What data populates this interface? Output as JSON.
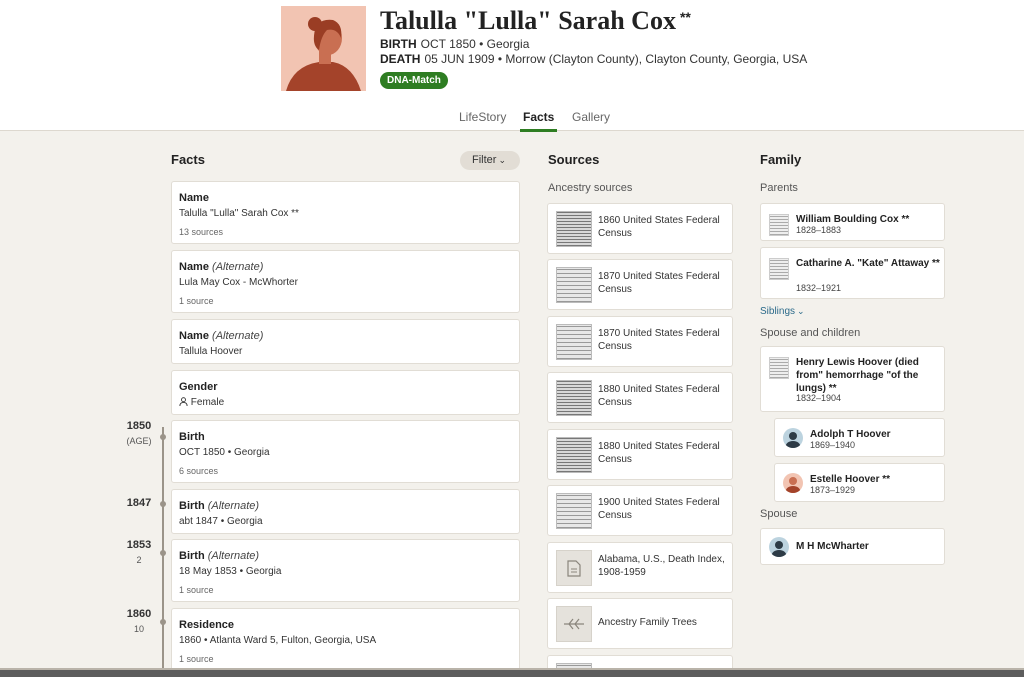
{
  "person": {
    "name": "Talulla \"Lulla\" Sarah Cox",
    "stars": "**",
    "birth_label": "BIRTH",
    "birth_value": "OCT 1850 • Georgia",
    "death_label": "DEATH",
    "death_value": "05 JUN 1909 • Morrow (Clayton County), Clayton County, Georgia, USA",
    "badge": "DNA-Match"
  },
  "tabs": [
    {
      "label": "LifeStory",
      "active": false
    },
    {
      "label": "Facts",
      "active": true
    },
    {
      "label": "Gallery",
      "active": false
    }
  ],
  "facts": {
    "title": "Facts",
    "filter_label": "Filter",
    "items": [
      {
        "type": "Name",
        "qualifier": "",
        "value": "Talulla \"Lulla\" Sarah Cox **",
        "sources": "13 sources"
      },
      {
        "type": "Name",
        "qualifier": "(Alternate)",
        "value": "Lula May Cox - McWhorter",
        "sources": "1 source"
      },
      {
        "type": "Name",
        "qualifier": "(Alternate)",
        "value": "Tallula Hoover",
        "sources": ""
      },
      {
        "type": "Gender",
        "qualifier": "",
        "value": "Female",
        "sources": ""
      },
      {
        "type": "Birth",
        "qualifier": "",
        "value": "OCT 1850 • Georgia",
        "sources": "6 sources"
      },
      {
        "type": "Birth",
        "qualifier": "(Alternate)",
        "value": "abt 1847 • Georgia",
        "sources": ""
      },
      {
        "type": "Birth",
        "qualifier": "(Alternate)",
        "value": "18 May 1853 • Georgia",
        "sources": "1 source"
      },
      {
        "type": "Residence",
        "qualifier": "",
        "value": "1860 • Atlanta Ward 5, Fulton, Georgia, USA",
        "sources": "1 source"
      }
    ]
  },
  "timeline": [
    {
      "year": "1850",
      "age": "(AGE)"
    },
    {
      "year": "1847",
      "age": ""
    },
    {
      "year": "1853",
      "age": "2"
    },
    {
      "year": "1860",
      "age": "10"
    }
  ],
  "sources": {
    "title": "Sources",
    "subtitle": "Ancestry sources",
    "items": [
      {
        "title": "1860 United States Federal Census",
        "thumb": "census"
      },
      {
        "title": "1870 United States Federal Census",
        "thumb": "census"
      },
      {
        "title": "1870 United States Federal Census",
        "thumb": "census"
      },
      {
        "title": "1880 United States Federal Census",
        "thumb": "census"
      },
      {
        "title": "1880 United States Federal Census",
        "thumb": "census"
      },
      {
        "title": "1900 United States Federal Census",
        "thumb": "census"
      },
      {
        "title": "Alabama, U.S., Death Index, 1908-1959",
        "thumb": "document-icon"
      },
      {
        "title": "Ancestry Family Trees",
        "thumb": "family-tree-icon"
      }
    ]
  },
  "family": {
    "title": "Family",
    "parents_label": "Parents",
    "parents": [
      {
        "name": "William Boulding Cox **",
        "dates": "1828–1883"
      },
      {
        "name": "Catharine A. \"Kate\" Attaway **",
        "dates": "1832–1921"
      }
    ],
    "siblings_label": "Siblings",
    "spouse_children_label": "Spouse and children",
    "spouse1": {
      "name": "Henry Lewis Hoover (died from\" hemorrhage \"of the lungs) **",
      "dates": "1832–1904"
    },
    "children": [
      {
        "name": "Adolph T Hoover",
        "dates": "1869–1940"
      },
      {
        "name": "Estelle Hoover **",
        "dates": "1873–1929"
      }
    ],
    "spouse_label": "Spouse",
    "spouse2": {
      "name": "M H McWharter"
    }
  },
  "colors": {
    "accent_green": "#2e7d22",
    "link_blue": "#2b6a8a",
    "portrait_bg": "#f2c4b2"
  }
}
